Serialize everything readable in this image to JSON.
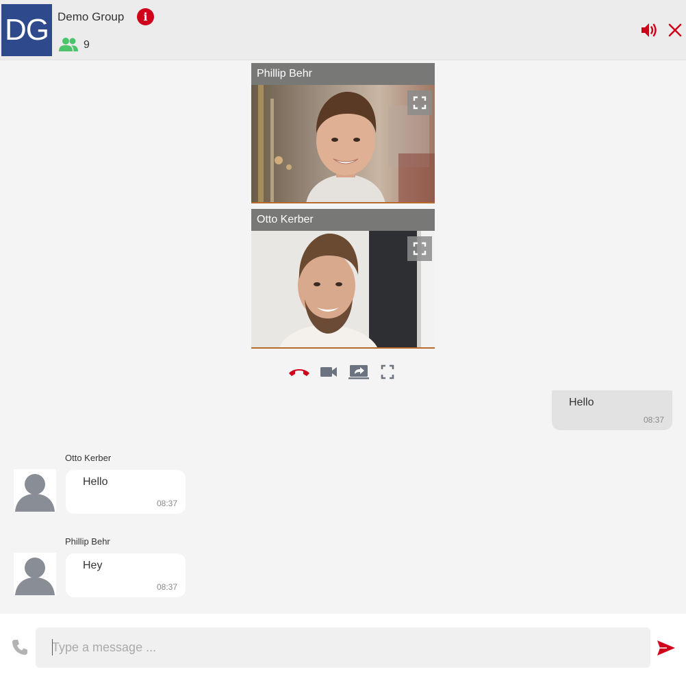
{
  "header": {
    "avatar_initials": "DG",
    "group_name": "Demo Group",
    "member_count": "9",
    "info_glyph": "i",
    "icons": {
      "info": "info-icon",
      "members": "group-icon",
      "sound": "volume-icon",
      "close": "close-icon"
    }
  },
  "colors": {
    "accent": "#d0021b",
    "members_green": "#4cc46a",
    "avatar_blue": "#2e4a8c",
    "control_gray": "#6b7280"
  },
  "videos": [
    {
      "name": "Phillip Behr"
    },
    {
      "name": "Otto Kerber"
    }
  ],
  "call_controls": [
    "hang-up-icon",
    "camera-icon",
    "screen-share-icon",
    "fullscreen-icon"
  ],
  "messages": [
    {
      "own": true,
      "text": "Hello",
      "time": "08:37"
    },
    {
      "own": false,
      "sender": "Otto Kerber",
      "text": "Hello",
      "time": "08:37"
    },
    {
      "own": false,
      "sender": "Phillip Behr",
      "text": "Hey",
      "time": "08:37"
    }
  ],
  "composer": {
    "placeholder": "Type a message ...",
    "value": ""
  }
}
